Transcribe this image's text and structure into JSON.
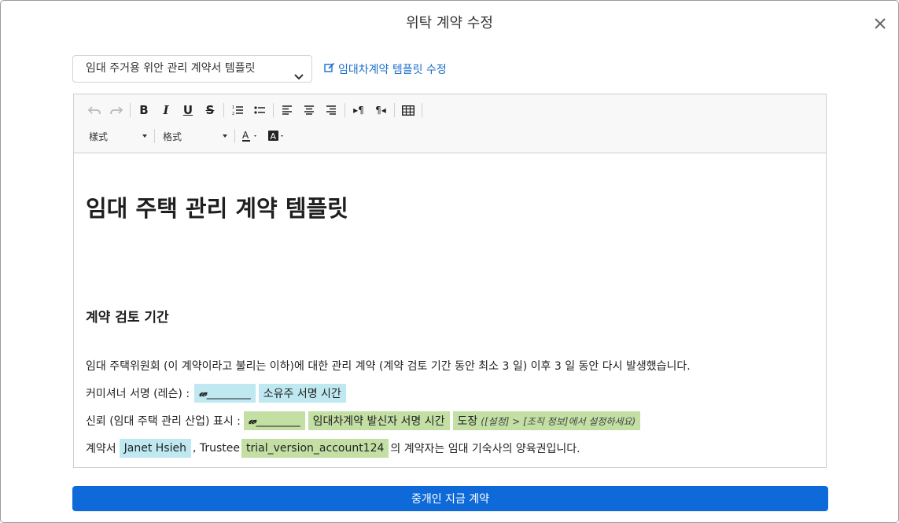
{
  "modal": {
    "title": "위탁 계약 수정"
  },
  "template": {
    "selected": "임대 주거용 위안 관리 계약서 템플릿",
    "edit_link": "임대차계약 템플릿 수정"
  },
  "toolbar": {
    "style_combo": "樣式",
    "format_combo": "格式"
  },
  "document": {
    "title": "임대 주택 관리 계약 템플릿",
    "section_title": "계약 검토 기간",
    "para1": "임대 주택위원회 (이 계약이라고 불리는 이하)에 대한 관리 계약 (계약 검토 기간 동안 최소 3 일) 이후 3 일 동안 다시 발생했습니다.",
    "para2": {
      "label": "커미셔너 서명 (레슨) :",
      "signature_blank": "________",
      "tag_owner_time": "소유주 서명 시간"
    },
    "para3": {
      "label": "신뢰 (임대 주택 관리 산업) 표시 :",
      "signature_blank": "________",
      "tag_sender_time": "임대차계약 발신자 서명 시간",
      "tag_stamp": "도장",
      "stamp_hint": "([설정] > [조직 정보]에서 설정하세요)"
    },
    "para4": {
      "prefix": "계약서",
      "name": "Janet Hsieh",
      "middle": ", Trustee",
      "account": "trial_version_account124",
      "suffix": "의 계약자는 임대 기숙사의 양육권입니다."
    }
  },
  "footer": {
    "submit_label": "중개인 지금 계약"
  }
}
